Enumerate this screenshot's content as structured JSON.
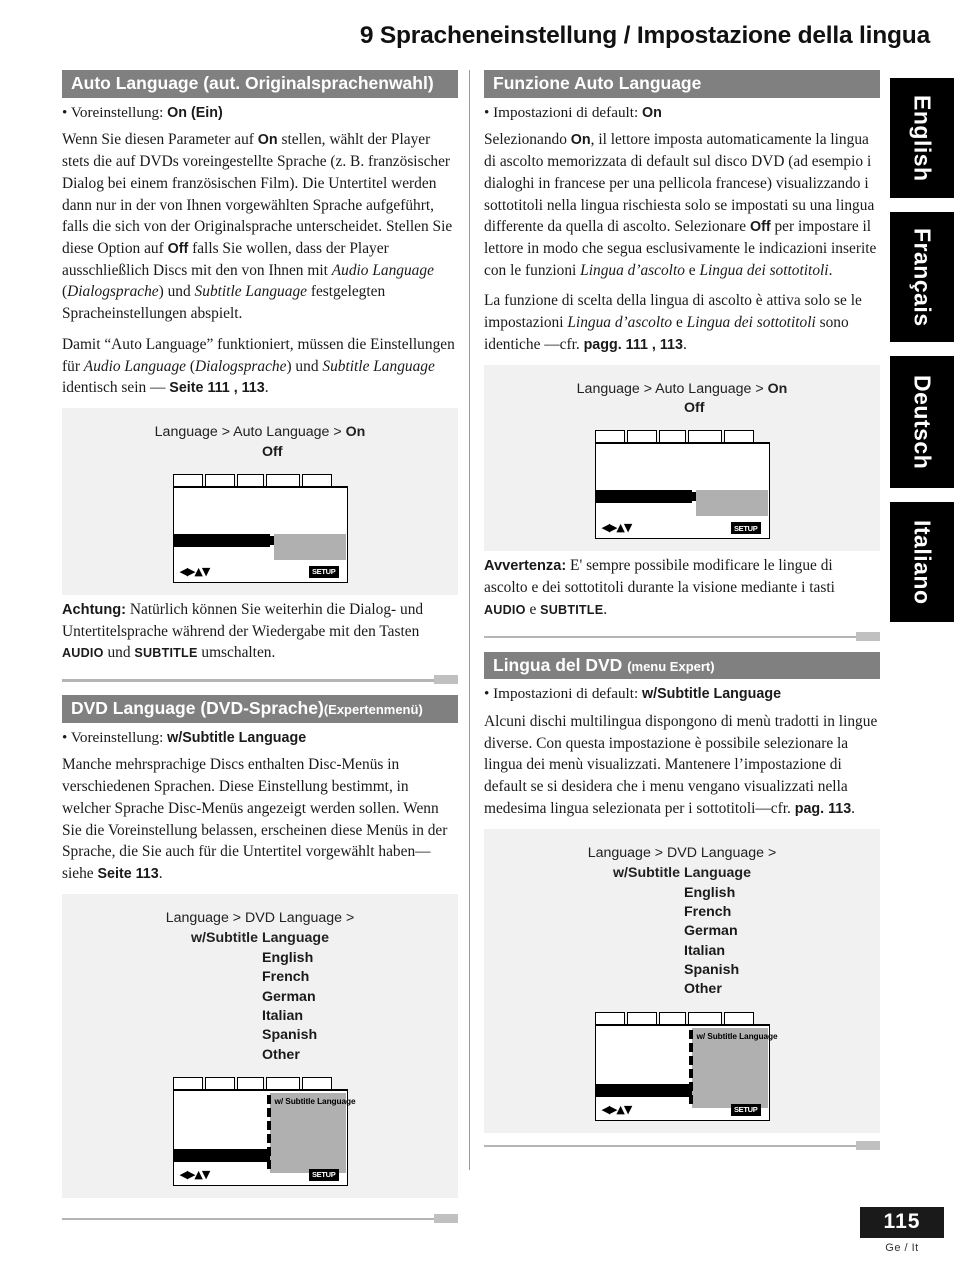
{
  "page": {
    "title": "9 Spracheneinstellung / Impostazione della lingua",
    "number": "115",
    "lang_code": "Ge / It"
  },
  "side_tabs": [
    {
      "label": "English"
    },
    {
      "label": "Français"
    },
    {
      "label": "Deutsch"
    },
    {
      "label": "Italiano"
    }
  ],
  "left": {
    "section1": {
      "heading": "Auto Language (aut. Originalsprachenwahl)",
      "heading_sub": "",
      "bullet_label": "• Voreinstellung: ",
      "bullet_value": "On (Ein)",
      "p1_a": "Wenn Sie diesen Parameter auf ",
      "p1_b": "On",
      "p1_c": " stellen, wählt der Player stets die auf DVDs voreingestellte Sprache (z. B. französischer Dialog bei einem französischen Film). Die Untertitel werden dann nur in der von Ihnen vorgewählten Sprache aufgeführt, falls die sich von der Originalsprache unterscheidet. Stellen Sie diese Option auf ",
      "p1_d": "Off",
      "p1_e": " falls Sie wollen, dass der Player ausschließlich Discs mit den von Ihnen mit ",
      "p1_f": "Audio Language",
      "p1_g": " (",
      "p1_h": "Dialogsprache",
      "p1_i": ") und ",
      "p1_j": "Subtitle Language",
      "p1_k": " festgelegten Spracheinstellungen abspielt.",
      "p2_a": "Damit “Auto Language” funktioniert, müssen die Einstellungen für ",
      "p2_b": "Audio Language",
      "p2_c": " (",
      "p2_d": "Dialogsprache",
      "p2_e": ") und ",
      "p2_f": "Subtitle Language",
      "p2_g": " identisch sein — ",
      "p2_h": "Seite 111 , 113",
      "p2_i": ".",
      "note_lead": "Achtung:",
      "note_a": " Natürlich können Sie weiterhin die Dialog- und Untertitelsprache während der Wiedergabe mit den Tasten ",
      "note_b": "AUDIO",
      "note_c": " und ",
      "note_d": "SUBTITLE",
      "note_e": " umschalten."
    },
    "diagram1": {
      "crumb_prefix": "Language > Auto Language > ",
      "crumb_selected": "On",
      "options": [
        "Off"
      ]
    },
    "section2": {
      "heading": "DVD Language (DVD-Sprache)",
      "heading_sub": "(Expertenmenü)",
      "bullet_label": "• Voreinstellung: ",
      "bullet_value": "w/Subtitle Language",
      "p1_a": "Manche mehrsprachige Discs enthalten Disc-Menüs in verschiedenen Sprachen. Diese Einstellung bestimmt, in welcher Sprache Disc-Menüs angezeigt werden sollen. Wenn Sie die Voreinstellung belassen, erscheinen diese Menüs in der Sprache, die Sie auch für die Untertitel vorgewählt haben—siehe ",
      "p1_b": "Seite 113",
      "p1_c": "."
    },
    "diagram2": {
      "crumb_prefix": "Language > DVD Language > ",
      "crumb_selected": "w/Subtitle Language",
      "options": [
        "English",
        "French",
        "German",
        "Italian",
        "Spanish",
        "Other"
      ],
      "osd_panel_label": "w/ Subtitle Language"
    }
  },
  "right": {
    "section1": {
      "heading": "Funzione Auto Language",
      "heading_sub": "",
      "bullet_label": "• Impostazioni di default: ",
      "bullet_value": "On",
      "p1_a": "Selezionando ",
      "p1_b": "On",
      "p1_c": ", il lettore imposta automaticamente la lingua di ascolto memorizzata di default sul disco DVD (ad esempio i dialoghi in francese per una pellicola francese) visualizzando i sottotitoli nella lingua rischiesta solo se impostati su una lingua differente da quella di ascolto. Selezionare ",
      "p1_d": "Off",
      "p1_e": " per impostare il lettore in modo che segua esclusivamente le indicazioni inserite con le funzioni ",
      "p1_f": "Lingua d’ascolto",
      "p1_g": " e ",
      "p1_h": "Lingua dei sottotitoli",
      "p1_i": ".",
      "p2_a": "La funzione di scelta della lingua di ascolto è attiva solo se le impostazioni ",
      "p2_b": "Lingua d’ascolto",
      "p2_c": " e ",
      "p2_d": "Lingua dei sottotitoli",
      "p2_e": " sono identiche —cfr. ",
      "p2_f": "pagg. 111 , 113",
      "p2_g": ".",
      "note_lead": "Avvertenza:",
      "note_a": " E' sempre possibile modificare le lingue di ascolto e dei sottotitoli durante la visione mediante i tasti ",
      "note_b": "AUDIO",
      "note_c": " e ",
      "note_d": "SUBTITLE",
      "note_e": "."
    },
    "diagram1": {
      "crumb_prefix": "Language > Auto Language > ",
      "crumb_selected": "On",
      "options": [
        "Off"
      ]
    },
    "section2": {
      "heading": "Lingua del DVD",
      "heading_sub": "(menu Expert)",
      "bullet_label": "• Impostazioni di default: ",
      "bullet_value": "w/Subtitle Language",
      "p1_a": "Alcuni dischi multilingua dispongono di menù  tradotti in lingue diverse. Con questa impostazione è possibile selezionare la lingua dei menù visualizzati. Mantenere l’impostazione di default se si desidera che i menu vengano visualizzati nella medesima lingua selezionata per i sottotitoli—cfr. ",
      "p1_b": "pag. 113",
      "p1_c": "."
    },
    "diagram2": {
      "crumb_prefix": "Language > DVD Language > ",
      "crumb_selected": "w/Subtitle Language",
      "options": [
        "English",
        "French",
        "German",
        "Italian",
        "Spanish",
        "Other"
      ],
      "osd_panel_label": "w/ Subtitle Language"
    }
  },
  "osd": {
    "setup_label": "SETUP",
    "arrows_glyphs": "◀▶▲▼"
  },
  "colors": {
    "header_bar": "#808080",
    "illus_bg": "#f1f1f1",
    "rule": "#b5b5b5",
    "osd_panel": "#b0b0b0"
  }
}
